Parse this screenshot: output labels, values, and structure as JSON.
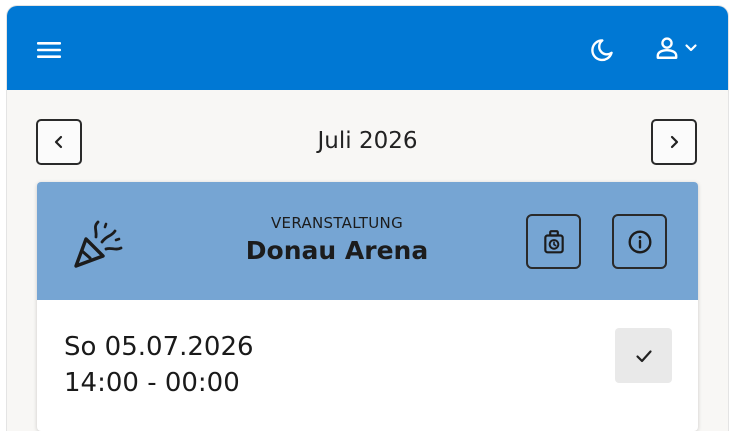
{
  "header": {
    "menu_icon": "hamburger-menu-icon",
    "theme_icon": "moon-icon",
    "user_icon": "user-icon",
    "accent_color": "#0078d4"
  },
  "calendar": {
    "month_label": "Juli 2026",
    "prev_icon": "chevron-left-icon",
    "next_icon": "chevron-right-icon"
  },
  "event": {
    "type_label": "VERANSTALTUNG",
    "venue": "Donau Arena",
    "header_color": "#76a5d3",
    "icons": [
      "party-popper-icon",
      "ticket-clock-icon",
      "info-icon",
      "check-icon"
    ],
    "date": "So 05.07.2026",
    "time": "14:00 - 00:00"
  }
}
